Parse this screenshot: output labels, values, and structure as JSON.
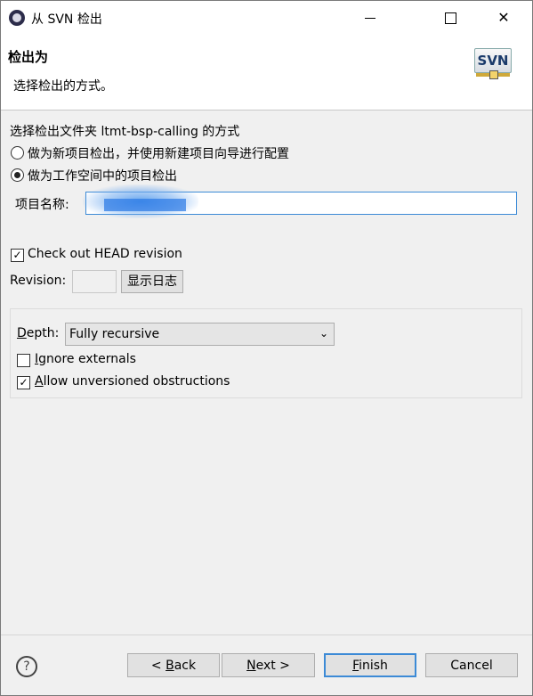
{
  "window": {
    "title": "从 SVN 检出",
    "controls": [
      "minimize-icon",
      "maximize-icon",
      "close-icon"
    ]
  },
  "banner": {
    "title": "检出为",
    "description": "选择检出的方式。",
    "logo_text": "SVN"
  },
  "method": {
    "prompt": "选择检出文件夹 ltmt-bsp-calling 的方式",
    "options": [
      {
        "label": "做为新项目检出，并使用新建项目向导进行配置",
        "selected": false
      },
      {
        "label": "做为工作空间中的项目检出",
        "selected": true
      }
    ]
  },
  "project": {
    "label": "项目名称:",
    "value": ""
  },
  "revision": {
    "head_label": "Check out HEAD revision",
    "head_checked": true,
    "revision_label": "Revision:",
    "revision_value": "",
    "show_log_label": "显示日志"
  },
  "options": {
    "depth_label": "Depth:",
    "depth_value": "Fully recursive",
    "ignore_externals_label": "Ignore externals",
    "ignore_externals_checked": false,
    "allow_obstructions_label": "Allow unversioned obstructions",
    "allow_obstructions_checked": true
  },
  "footer": {
    "help_icon": "help-icon",
    "back_label": "< Back",
    "next_label": "Next >",
    "finish_label": "Finish",
    "cancel_label": "Cancel"
  }
}
